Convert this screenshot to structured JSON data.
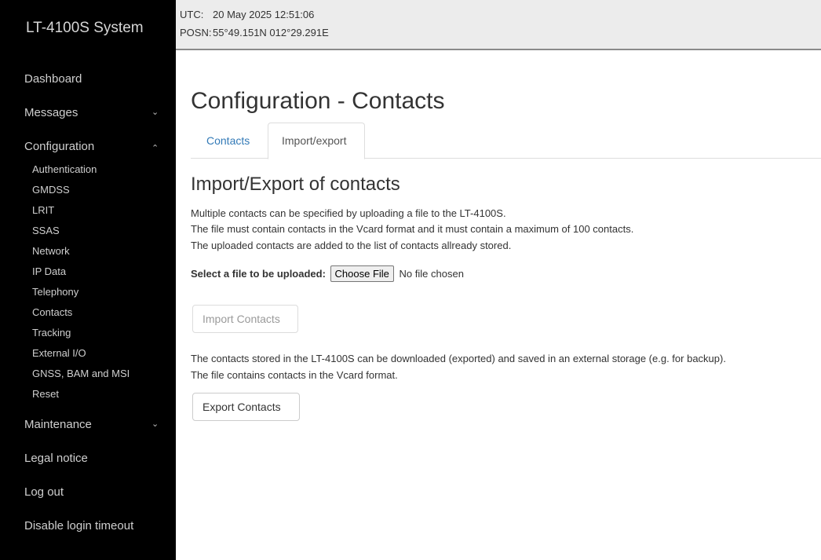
{
  "app": {
    "brand": "LT-4100S System"
  },
  "status": {
    "utc_label": "UTC:",
    "utc_value": "20 May 2025 12:51:06",
    "posn_label": "POSN:",
    "posn_value": "55°49.151N 012°29.291E"
  },
  "sidebar": {
    "items": [
      {
        "label": "Dashboard"
      },
      {
        "label": "Messages",
        "chevron": "⌄"
      },
      {
        "label": "Configuration",
        "chevron": "⌃"
      },
      {
        "label": "Maintenance",
        "chevron": "⌄"
      },
      {
        "label": "Legal notice"
      },
      {
        "label": "Log out"
      },
      {
        "label": "Disable login timeout"
      }
    ],
    "config_sub": [
      "Authentication",
      "GMDSS",
      "LRIT",
      "SSAS",
      "Network",
      "IP Data",
      "Telephony",
      "Contacts",
      "Tracking",
      "External I/O",
      "GNSS, BAM and MSI",
      "Reset"
    ]
  },
  "main": {
    "title": "Configuration - Contacts",
    "tabs": [
      {
        "label": "Contacts"
      },
      {
        "label": "Import/export"
      }
    ],
    "section_title": "Import/Export of contacts",
    "intro": [
      "Multiple contacts can be specified by uploading a file to the LT-4100S.",
      "The file must contain contacts in the Vcard format and it must contain a maximum of 100 contacts.",
      "The uploaded contacts are added to the list of contacts allready stored."
    ],
    "upload_label": "Select a file to be uploaded:",
    "choose_file_label": "Choose File",
    "file_status": "No file chosen",
    "import_button": "Import Contacts",
    "export_text": [
      "The contacts stored in the LT-4100S can be downloaded (exported) and saved in an external storage (e.g. for backup).",
      "The file contains contacts in the Vcard format."
    ],
    "export_button": "Export Contacts"
  }
}
